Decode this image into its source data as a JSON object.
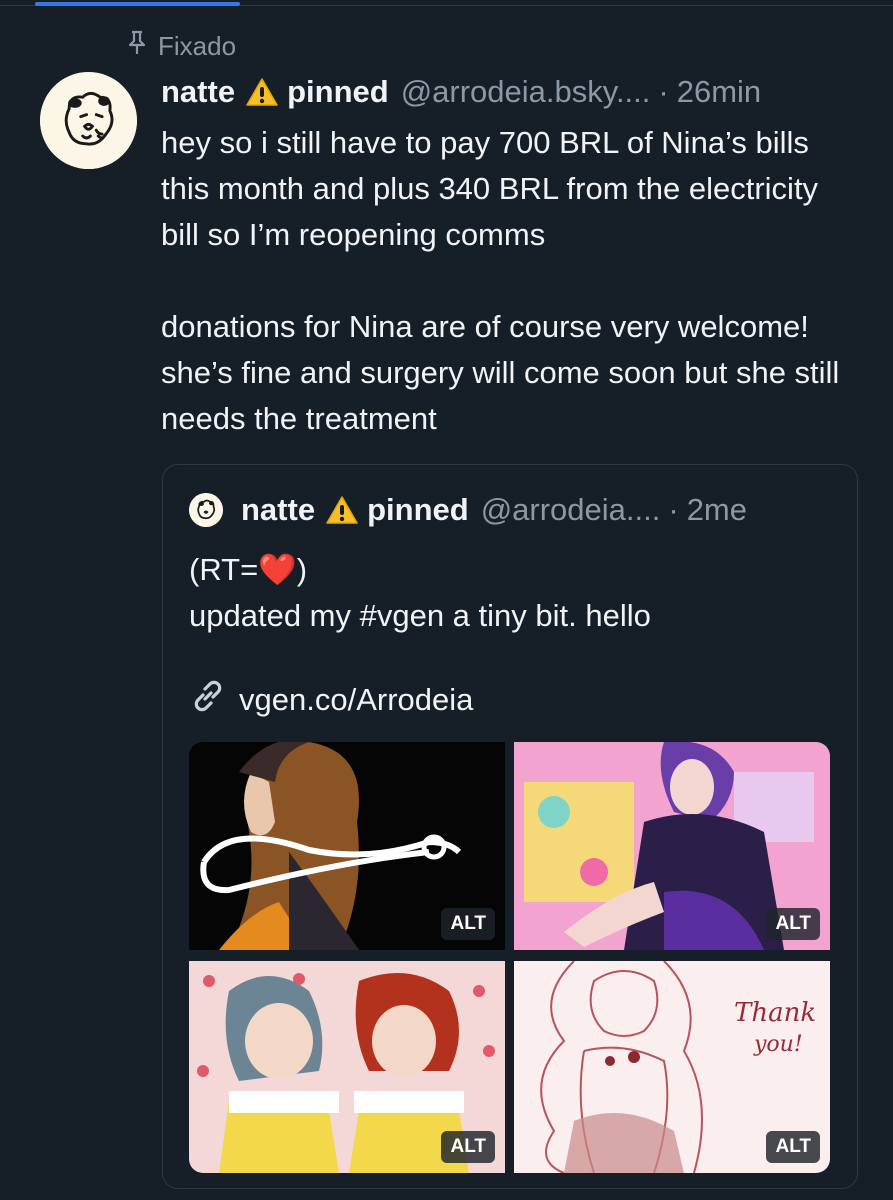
{
  "pinned_label": "Fixado",
  "post": {
    "author_name": "natte",
    "author_suffix": "pinned",
    "handle": "@arrodeia.bsky....",
    "separator": "·",
    "time": "26min",
    "paragraphs": [
      "hey so i still have to pay 700 BRL of Nina’s bills this month and plus 340 BRL from the electricity bill so I’m reopening comms",
      "donations for Nina are of course very welcome! she’s fine and surgery will come soon but she still needs the treatment"
    ]
  },
  "quote": {
    "author_name": "natte",
    "author_suffix": "pinned",
    "handle": "@arrodeia....",
    "separator": "·",
    "time": "2me",
    "line1": "(RT=❤️)",
    "line2": "updated my #vgen a tiny bit. hello",
    "link": "vgen.co/Arrodeia",
    "images": [
      {
        "alt_badge": "ALT"
      },
      {
        "alt_badge": "ALT"
      },
      {
        "alt_badge": "ALT"
      },
      {
        "alt_badge": "ALT"
      }
    ]
  },
  "colors": {
    "background": "#161e27",
    "muted_text": "#8b98a5",
    "accent": "#2f7ce8",
    "border": "#2e3945"
  }
}
